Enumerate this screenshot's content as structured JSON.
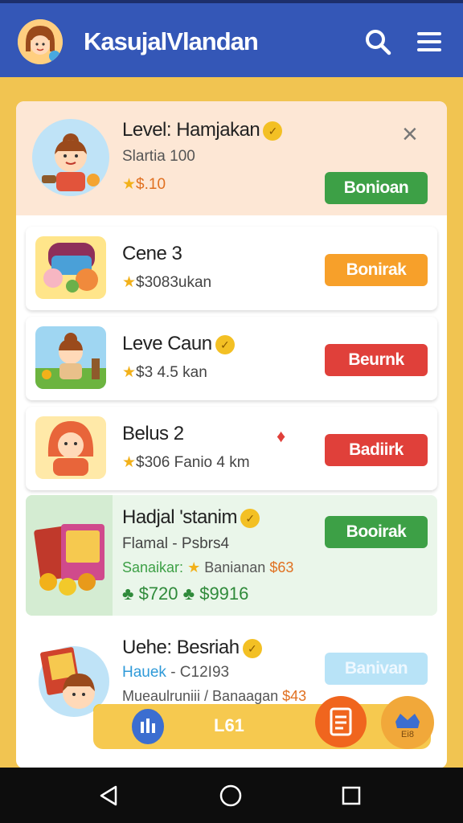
{
  "app": {
    "title": "KasujalVlandan"
  },
  "header_card": {
    "title": "Level: Hamjakan",
    "subtitle": "Slartia 100",
    "price": "$.10",
    "button": "Bonioan",
    "close_glyph": "×"
  },
  "items": [
    {
      "title": "Cene 3",
      "price": "$3083ukan",
      "button": "Bonirak"
    },
    {
      "title": "Leve Caun",
      "price": "$3 4.5  kan",
      "button": "Beurnk"
    },
    {
      "title": "Belus 2",
      "price": "$306 Fanio 4 km",
      "button": "Badiirk"
    }
  ],
  "featured": {
    "title": "Hadjal 'stanim",
    "line1": "Flamal - Psbrs4",
    "line2_left": "Sanaikar",
    "line2_right": "Banianan",
    "line2_price": "$63",
    "price_a": "$720",
    "price_b": "$9916",
    "button": "Booirak"
  },
  "last": {
    "title": "Uehe: Besriah",
    "line1_left": "Hauek",
    "line1_right": "- C12I93",
    "line2": "Mueaulruniii / Banaagan",
    "line2_price": "$43",
    "button": "Banivan"
  },
  "bottom_bar": {
    "center": "L61",
    "badge": "Ei8"
  },
  "colors": {
    "appbar": "#3457b7",
    "background": "#f1c451",
    "green": "#3da046",
    "orange": "#f7a02a",
    "red": "#e0403a"
  }
}
